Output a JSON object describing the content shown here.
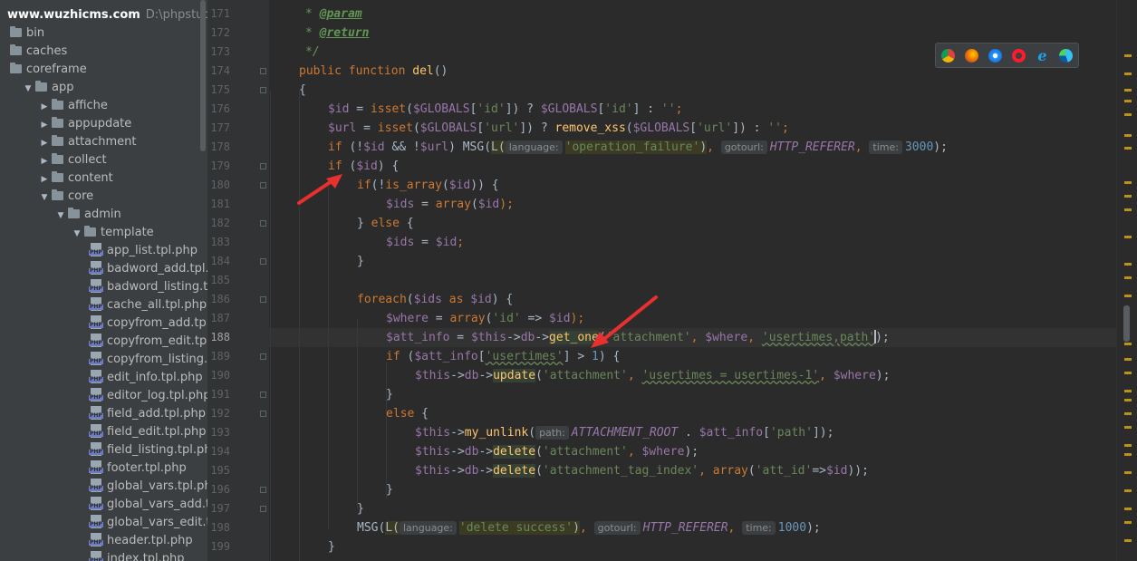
{
  "project": {
    "name": "www.wuzhicms.com",
    "path": "D:\\phpstudy_pro"
  },
  "tree": [
    {
      "label": "bin",
      "type": "folder",
      "depth": 0,
      "expanded": null
    },
    {
      "label": "caches",
      "type": "folder",
      "depth": 0,
      "expanded": null
    },
    {
      "label": "coreframe",
      "type": "folder",
      "depth": 0,
      "expanded": null
    },
    {
      "label": "app",
      "type": "folder",
      "depth": 1,
      "expanded": true
    },
    {
      "label": "affiche",
      "type": "folder",
      "depth": 2,
      "expanded": false
    },
    {
      "label": "appupdate",
      "type": "folder",
      "depth": 2,
      "expanded": false
    },
    {
      "label": "attachment",
      "type": "folder",
      "depth": 2,
      "expanded": false
    },
    {
      "label": "collect",
      "type": "folder",
      "depth": 2,
      "expanded": false
    },
    {
      "label": "content",
      "type": "folder",
      "depth": 2,
      "expanded": false
    },
    {
      "label": "core",
      "type": "folder",
      "depth": 2,
      "expanded": true
    },
    {
      "label": "admin",
      "type": "folder",
      "depth": 3,
      "expanded": true
    },
    {
      "label": "template",
      "type": "folder",
      "depth": 4,
      "expanded": true
    },
    {
      "label": "app_list.tpl.php",
      "type": "file",
      "depth": 5
    },
    {
      "label": "badword_add.tpl.php",
      "type": "file",
      "depth": 5
    },
    {
      "label": "badword_listing.tpl.php",
      "type": "file",
      "depth": 5
    },
    {
      "label": "cache_all.tpl.php",
      "type": "file",
      "depth": 5
    },
    {
      "label": "copyfrom_add.tpl.php",
      "type": "file",
      "depth": 5
    },
    {
      "label": "copyfrom_edit.tpl.php",
      "type": "file",
      "depth": 5
    },
    {
      "label": "copyfrom_listing.tpl.php",
      "type": "file",
      "depth": 5
    },
    {
      "label": "edit_info.tpl.php",
      "type": "file",
      "depth": 5
    },
    {
      "label": "editor_log.tpl.php",
      "type": "file",
      "depth": 5
    },
    {
      "label": "field_add.tpl.php",
      "type": "file",
      "depth": 5
    },
    {
      "label": "field_edit.tpl.php",
      "type": "file",
      "depth": 5
    },
    {
      "label": "field_listing.tpl.php",
      "type": "file",
      "depth": 5
    },
    {
      "label": "footer.tpl.php",
      "type": "file",
      "depth": 5
    },
    {
      "label": "global_vars.tpl.php",
      "type": "file",
      "depth": 5
    },
    {
      "label": "global_vars_add.tpl.php",
      "type": "file",
      "depth": 5
    },
    {
      "label": "global_vars_edit.tpl.php",
      "type": "file",
      "depth": 5
    },
    {
      "label": "header.tpl.php",
      "type": "file",
      "depth": 5
    },
    {
      "label": "index.tpl.php",
      "type": "file",
      "depth": 5
    }
  ],
  "lines": [
    171,
    172,
    173,
    174,
    175,
    176,
    177,
    178,
    179,
    180,
    181,
    182,
    183,
    184,
    185,
    186,
    187,
    188,
    189,
    190,
    191,
    192,
    193,
    194,
    195,
    196,
    197,
    198,
    199
  ],
  "active_line": 188,
  "code": {
    "l171": [
      "* ",
      "@param"
    ],
    "l172": [
      "* ",
      "@return"
    ],
    "l173": [
      "*/"
    ],
    "l174": [
      "public",
      "function",
      "del",
      "()"
    ],
    "l175": [
      "{"
    ],
    "l176": [
      "$id",
      " = ",
      "isset",
      "(",
      "$GLOBALS",
      "[",
      "'id'",
      "]) ? ",
      "$GLOBALS",
      "[",
      "'id'",
      "] : ",
      "''",
      ";"
    ],
    "l177": [
      "$url",
      " = ",
      "isset",
      "(",
      "$GLOBALS",
      "[",
      "'url'",
      "]) ? ",
      "remove_xss",
      "(",
      "$GLOBALS",
      "[",
      "'url'",
      "]) : ",
      "''",
      ";"
    ],
    "l178": [
      "if",
      " (!",
      "$id",
      " && !",
      "$url",
      ") MSG(",
      "L",
      "(",
      "language:",
      "'operation_failure'",
      ")",
      ", ",
      "gotourl:",
      "HTTP_REFERER",
      ", ",
      "time:",
      "3000",
      ");"
    ],
    "l179": [
      "if",
      " (",
      "$id",
      ") {"
    ],
    "l180": [
      "if",
      "(!",
      "is_array",
      "(",
      "$id",
      ")) {"
    ],
    "l181": [
      "$ids",
      " = ",
      "array",
      "(",
      "$id",
      ");"
    ],
    "l182": [
      "} ",
      "else",
      " {"
    ],
    "l183": [
      "$ids",
      " = ",
      "$id",
      ";"
    ],
    "l184": [
      "}"
    ],
    "l186": [
      "foreach",
      "(",
      "$ids",
      " as ",
      "$id",
      ") {"
    ],
    "l187": [
      "$where",
      " = ",
      "array",
      "(",
      "'id'",
      " => ",
      "$id",
      ");"
    ],
    "l188": [
      "$att_info",
      " = ",
      "$this",
      "->",
      "db",
      "->",
      "get_one",
      "(",
      "'attachment'",
      ", ",
      "$where",
      ", ",
      "'usertimes,path'",
      ");"
    ],
    "l189": [
      "if",
      " (",
      "$att_info",
      "[",
      "'usertimes'",
      "] > ",
      "1",
      ") {"
    ],
    "l190": [
      "$this",
      "->",
      "db",
      "->",
      "update",
      "(",
      "'attachment'",
      ", ",
      "'usertimes = usertimes-1'",
      ", ",
      "$where",
      ");"
    ],
    "l191": [
      "}"
    ],
    "l192": [
      "else",
      " {"
    ],
    "l193": [
      "$this",
      "->",
      "my_unlink",
      "(",
      "path:",
      "ATTACHMENT_ROOT",
      " . ",
      "$att_info",
      "[",
      "'path'",
      "]);"
    ],
    "l194": [
      "$this",
      "->",
      "db",
      "->",
      "delete",
      "(",
      "'attachment'",
      ", ",
      "$where",
      ");"
    ],
    "l195": [
      "$this",
      "->",
      "db",
      "->",
      "delete",
      "(",
      "'attachment_tag_index'",
      ", ",
      "array",
      "(",
      "'att_id'",
      "=>",
      "$id",
      "));"
    ],
    "l196": [
      "}"
    ],
    "l197": [
      "}"
    ],
    "l198": [
      "MSG(",
      "L",
      "(",
      "language:",
      "'delete success'",
      ")",
      ", ",
      "gotourl:",
      "HTTP_REFERER",
      ", ",
      "time:",
      "1000",
      ");"
    ],
    "l199": [
      "}"
    ]
  },
  "browsers": [
    "chrome-icon",
    "firefox-icon",
    "safari-icon",
    "opera-icon",
    "ie-icon",
    "edge-icon"
  ],
  "colors": {
    "annotation_arrow": "#e8302e",
    "keyword": "#cc7832",
    "string": "#6a8759",
    "variable": "#9876aa",
    "function": "#ffc66d"
  }
}
